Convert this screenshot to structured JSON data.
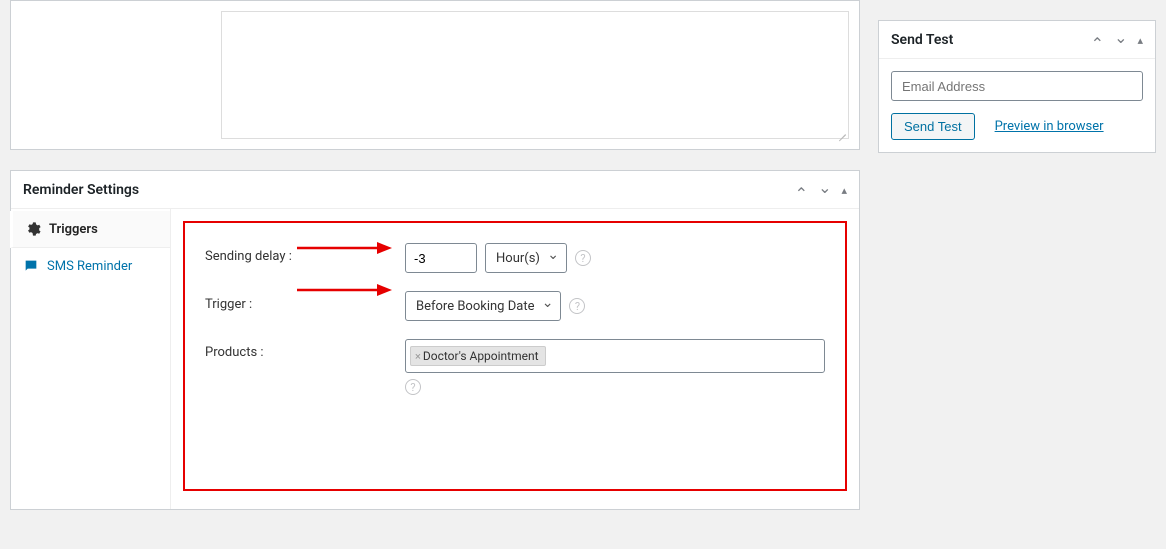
{
  "reminder": {
    "title": "Reminder Settings",
    "tabs": {
      "triggers": "Triggers",
      "sms": "SMS Reminder"
    },
    "form": {
      "sending_delay_label": "Sending delay :",
      "sending_delay_value": "-3",
      "sending_delay_unit": "Hour(s)",
      "trigger_label": "Trigger :",
      "trigger_value": "Before Booking Date",
      "products_label": "Products :",
      "products_tag": "Doctor's Appointment"
    }
  },
  "send_test": {
    "title": "Send Test",
    "email_placeholder": "Email Address",
    "send_button": "Send Test",
    "preview_link": "Preview in browser"
  }
}
